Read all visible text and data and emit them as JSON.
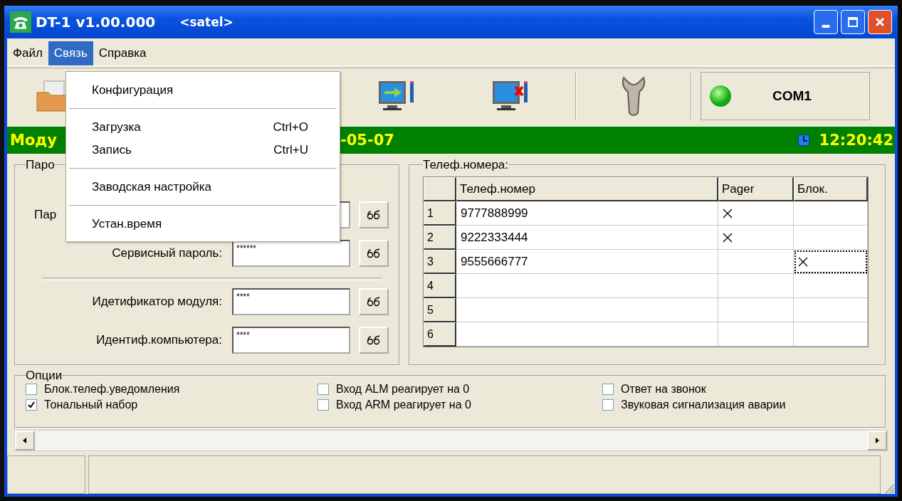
{
  "window": {
    "title": "DT-1 v1.00.000",
    "subtitle": "<satel>"
  },
  "menu": [
    {
      "label": "Файл",
      "selected": false
    },
    {
      "label": "Связь",
      "selected": true
    },
    {
      "label": "Справка",
      "selected": false
    }
  ],
  "dropdown": [
    {
      "kind": "item",
      "label": "Конфигурация"
    },
    {
      "kind": "separator"
    },
    {
      "kind": "item",
      "label": "Загрузка",
      "shortcut": "Ctrl+O"
    },
    {
      "kind": "item",
      "label": "Запись",
      "shortcut": "Ctrl+U"
    },
    {
      "kind": "separator"
    },
    {
      "kind": "item",
      "label": "Заводская настройка"
    },
    {
      "kind": "separator"
    },
    {
      "kind": "item",
      "label": "Устан.время"
    }
  ],
  "toolbar": {
    "port": "COM1",
    "connected": true
  },
  "info_bar": {
    "module": "Моду",
    "date": "-05-07",
    "time": "12:20:42"
  },
  "passwords": {
    "title": "Паро",
    "fields": [
      {
        "label": "Пар"
      },
      {
        "label": "Сервисный пароль:",
        "value": "******"
      },
      {
        "label": "Идетификатор модуля:",
        "value": "****"
      },
      {
        "label": "Идентиф.компьютера:",
        "value": "****"
      }
    ]
  },
  "phones": {
    "title": "Телеф.номера:",
    "columns": [
      "Телеф.номер",
      "Pager",
      "Блок."
    ],
    "rows": [
      {
        "index": "1",
        "number": "9777888999",
        "pager": true,
        "block": false,
        "focused": false
      },
      {
        "index": "2",
        "number": "9222333444",
        "pager": true,
        "block": false,
        "focused": false
      },
      {
        "index": "3",
        "number": "9555666777",
        "pager": false,
        "block": true,
        "focused": true
      },
      {
        "index": "4",
        "pager": false,
        "block": false,
        "focused": false
      },
      {
        "index": "5",
        "pager": false,
        "block": false,
        "focused": false
      },
      {
        "index": "6",
        "pager": false,
        "block": false,
        "focused": false
      }
    ]
  },
  "options": {
    "title": "Опции",
    "items": [
      {
        "label": "Блок.телеф.уведомления",
        "checked": false
      },
      {
        "label": "Вход ALM реагирует на 0",
        "checked": false
      },
      {
        "label": "Ответ на звонок",
        "checked": false
      },
      {
        "label": "Тональный набор",
        "checked": true
      },
      {
        "label": "Вход ARM реагирует на 0",
        "checked": false
      },
      {
        "label": "Звуковая сигнализация аварии",
        "checked": false
      }
    ]
  }
}
